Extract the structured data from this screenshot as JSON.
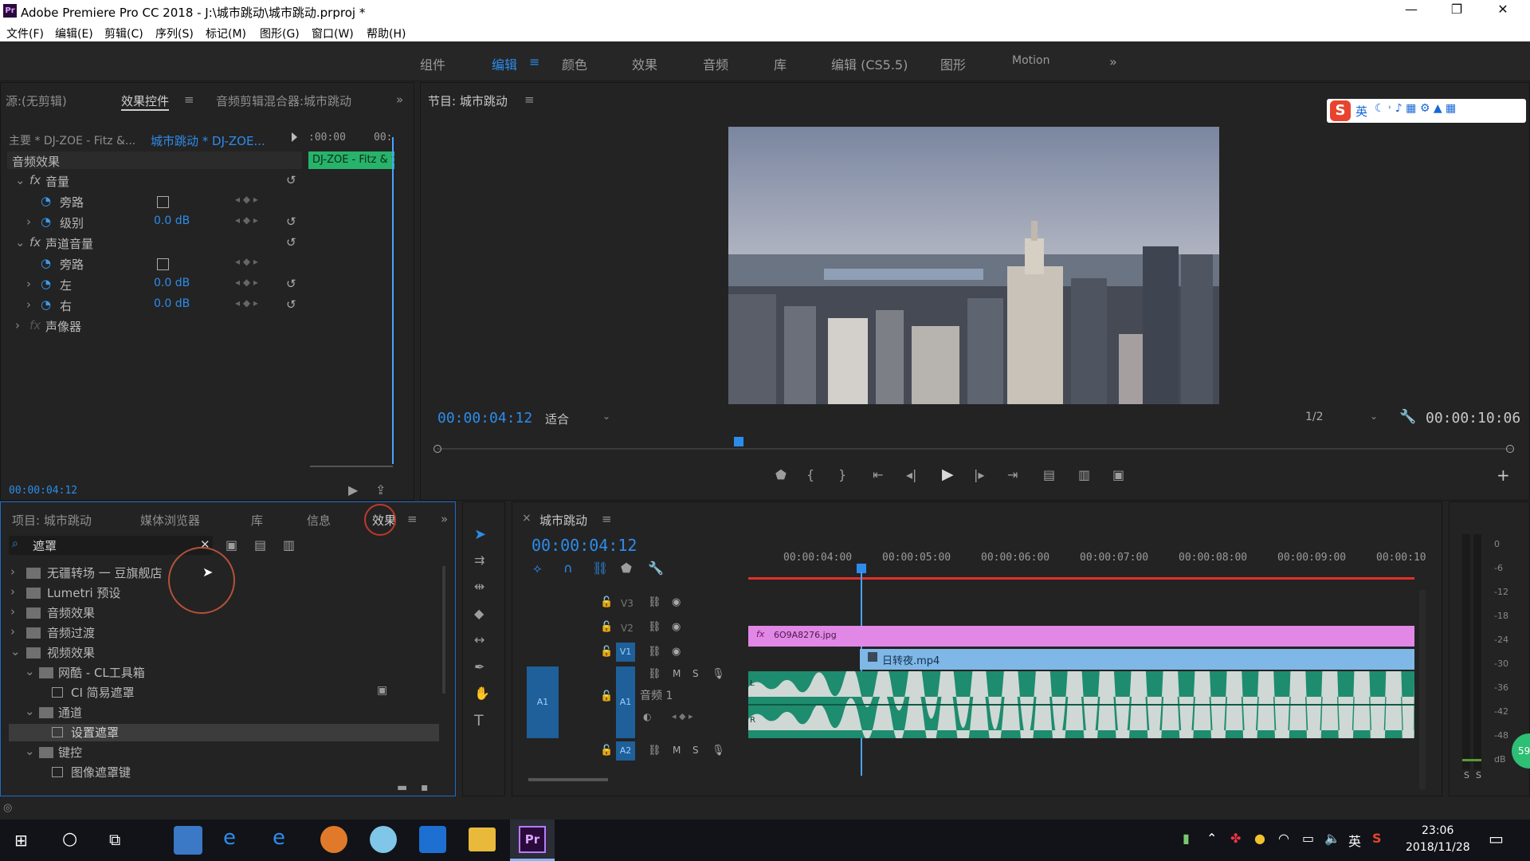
{
  "window": {
    "title": "Adobe Premiere Pro CC 2018 - J:\\城市跳动\\城市跳动.prproj *",
    "app_badge": "Pr",
    "minimize": "—",
    "restore": "❐",
    "close": "✕"
  },
  "menu": [
    "文件(F)",
    "编辑(E)",
    "剪辑(C)",
    "序列(S)",
    "标记(M)",
    "图形(G)",
    "窗口(W)",
    "帮助(H)"
  ],
  "workspaces": {
    "tabs": [
      "组件",
      "编辑",
      "颜色",
      "效果",
      "音频",
      "库",
      "编辑 (CS5.5)",
      "图形",
      "Motion"
    ],
    "active": "编辑",
    "active_menu": "≡",
    "more": "»"
  },
  "source_panel": {
    "tabs": [
      "源:(无剪辑)",
      "效果控件",
      "音频剪辑混合器:城市跳动"
    ],
    "active_tab_menu": "≡",
    "more": "»",
    "master_label": "主要 * DJ-ZOE - Fitz &...",
    "clip_label": "城市跳动 * DJ-ZOE...",
    "ruler_start": ":00:00",
    "ruler_end": "00:",
    "clip_bar": "DJ-ZOE - Fitz & t",
    "section": "音频效果",
    "rows": [
      {
        "fx": "fx",
        "name": "音量",
        "value": ""
      },
      {
        "name": "旁路",
        "value": ""
      },
      {
        "name": "级别",
        "value": "0.0 dB"
      },
      {
        "fx": "fx",
        "name": "声道音量",
        "value": ""
      },
      {
        "name": "旁路",
        "value": ""
      },
      {
        "name": "左",
        "value": "0.0 dB"
      },
      {
        "name": "右",
        "value": "0.0 dB"
      },
      {
        "fx": "fx",
        "name": "声像器",
        "value": ""
      }
    ],
    "timecode": "00:00:04:12"
  },
  "program": {
    "title": "节目: 城市跳动",
    "title_menu": "≡",
    "timecode": "00:00:04:12",
    "fit": "适合",
    "resolution": "1/2",
    "duration": "00:00:10:06",
    "add": "+"
  },
  "ime_toolbar": {
    "logo": "S",
    "lang": "英"
  },
  "project_panel": {
    "tabs": [
      "项目: 城市跳动",
      "媒体浏览器",
      "库",
      "信息",
      "效果"
    ],
    "active_tab_menu": "≡",
    "more": "»",
    "search_value": "遮罩",
    "tree": [
      {
        "label": "无疆转场 一 豆旗舰店",
        "level": 0,
        "type": "folder",
        "arrow": "›"
      },
      {
        "label": "Lumetri 预设",
        "level": 0,
        "type": "folder",
        "arrow": "›"
      },
      {
        "label": "音频效果",
        "level": 0,
        "type": "folder",
        "arrow": "›"
      },
      {
        "label": "音频过渡",
        "level": 0,
        "type": "folder",
        "arrow": "›"
      },
      {
        "label": "视频效果",
        "level": 0,
        "type": "folder",
        "arrow": "⌄"
      },
      {
        "label": "网酷 - CL工具箱",
        "level": 1,
        "type": "folder",
        "arrow": "⌄"
      },
      {
        "label": "CI 简易遮罩",
        "level": 2,
        "type": "effect"
      },
      {
        "label": "通道",
        "level": 1,
        "type": "folder",
        "arrow": "⌄"
      },
      {
        "label": "设置遮罩",
        "level": 2,
        "type": "effect",
        "selected": true
      },
      {
        "label": "键控",
        "level": 1,
        "type": "folder",
        "arrow": "⌄"
      },
      {
        "label": "图像遮罩键",
        "level": 2,
        "type": "effect"
      }
    ]
  },
  "timeline": {
    "title": "城市跳动",
    "close": "×",
    "title_menu": "≡",
    "timecode": "00:00:04:12",
    "ruler": [
      "00:00:04:00",
      "00:00:05:00",
      "00:00:06:00",
      "00:00:07:00",
      "00:00:08:00",
      "00:00:09:00",
      "00:00:10"
    ],
    "tracks": [
      {
        "id": "V3"
      },
      {
        "id": "V2"
      },
      {
        "id": "V1",
        "target": true
      },
      {
        "id": "A1",
        "target": true,
        "source": "A1",
        "name": "音频 1",
        "m": "M",
        "s": "S"
      },
      {
        "id": "A2",
        "m": "M",
        "s": "S"
      }
    ],
    "clips": {
      "v2": "6O9A8276.jpg",
      "v2_fx": "fx",
      "v1": "日转夜.mp4",
      "a1_label": "L",
      "a1_r": "R"
    }
  },
  "meter": {
    "scale": [
      "0",
      "-6",
      "-12",
      "-18",
      "-24",
      "-30",
      "-36",
      "-42",
      "-48",
      "dB"
    ],
    "solo": [
      "S",
      "S"
    ],
    "badge": "59"
  },
  "taskbar": {
    "lang": "英",
    "time": "23:06",
    "date": "2018/11/28"
  },
  "colors": {
    "accent": "#2d8ceb",
    "clip_pink": "#e187e6",
    "clip_blue": "#7fb7e6",
    "audio_green": "#1e8c6e",
    "playhead": "#4aa3ff",
    "highlight_circle": "#c0392b"
  }
}
